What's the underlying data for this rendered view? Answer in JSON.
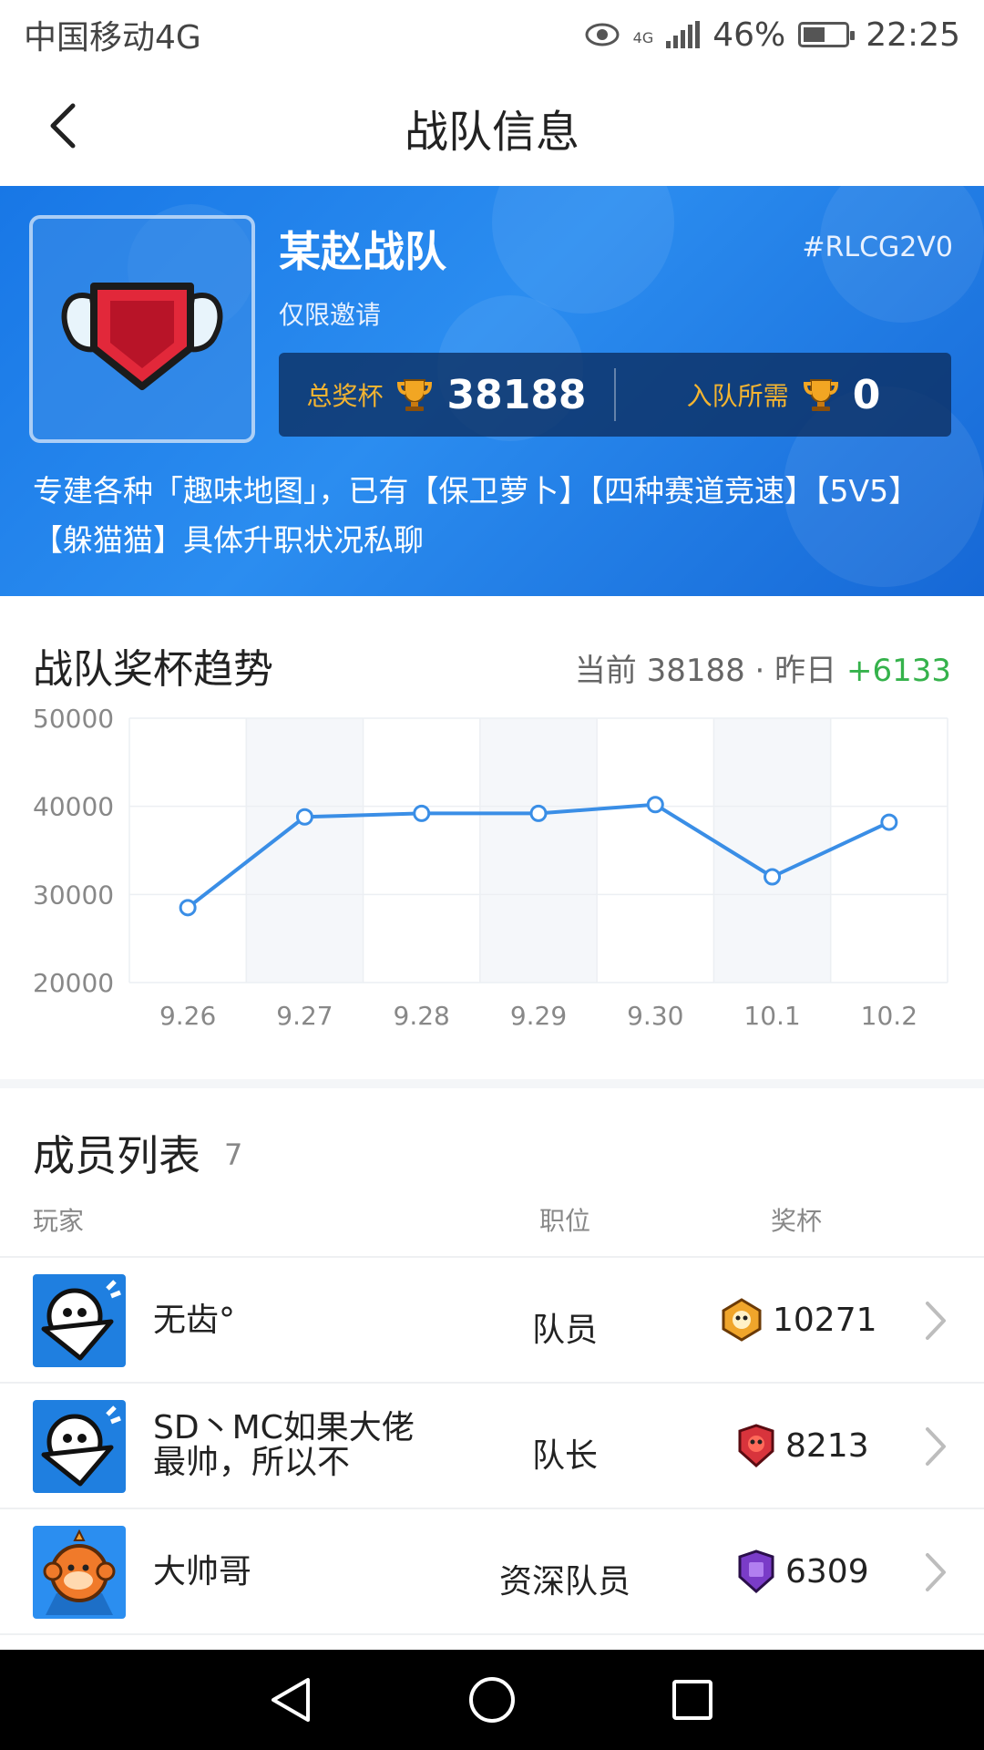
{
  "status_bar": {
    "carrier": "中国移动4G",
    "network": "4G",
    "battery_percent": "46%",
    "time": "22:25"
  },
  "header": {
    "title": "战队信息",
    "back_icon": "chevron-left-icon"
  },
  "team": {
    "name": "某赵战队",
    "tag": "#RLCG2V0",
    "join_type": "仅限邀请",
    "total_trophies_label": "总奖杯",
    "total_trophies": "38188",
    "required_label": "入队所需",
    "required_trophies": "0",
    "description": "专建各种「趣味地图」，已有【保卫萝卜】【四种赛道竞速】【5V5】【躲猫猫】具体升职状况私聊"
  },
  "trend": {
    "title": "战队奖杯趋势",
    "current_label": "当前",
    "current_value": "38188",
    "separator": "·",
    "yesterday_label": "昨日",
    "delta": "+6133"
  },
  "chart_data": {
    "type": "line",
    "categories": [
      "9.26",
      "9.27",
      "9.28",
      "9.29",
      "9.30",
      "10.1",
      "10.2"
    ],
    "values": [
      28500,
      38800,
      39200,
      39200,
      40200,
      32000,
      38200
    ],
    "y_ticks": [
      50000,
      40000,
      30000,
      20000
    ],
    "ylim": [
      20000,
      50000
    ],
    "grid": true,
    "line_color": "#3a8ee6",
    "title": "",
    "xlabel": "",
    "ylabel": ""
  },
  "members": {
    "title": "成员列表",
    "count": "7",
    "col_player": "玩家",
    "col_role": "职位",
    "col_trophies": "奖杯",
    "rows": [
      {
        "name": "无齿°",
        "role": "队员",
        "trophies": "10271",
        "rank_color": "#f0a52b"
      },
      {
        "name": "SD丶MC如果大佬最帅，所以不",
        "role": "队长",
        "trophies": "8213",
        "rank_color": "#d8343c"
      },
      {
        "name": "大帅哥",
        "role": "资深队员",
        "trophies": "6309",
        "rank_color": "#7a3cc8"
      }
    ]
  },
  "colors": {
    "accent_blue": "#1877e6",
    "gold": "#f3b431",
    "positive": "#35b24b"
  }
}
